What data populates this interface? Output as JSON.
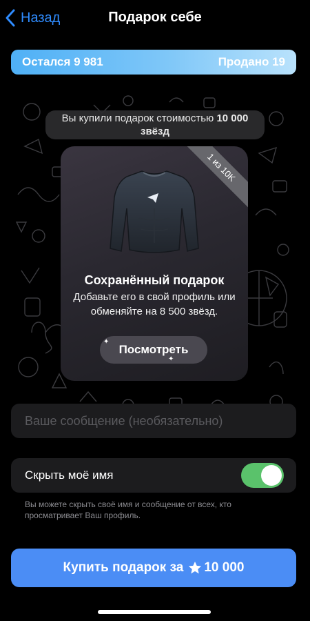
{
  "nav": {
    "back_label": "Назад",
    "title": "Подарок себе"
  },
  "stock": {
    "remaining": "Остался 9 981",
    "sold": "Продано 19"
  },
  "purchase_note": {
    "prefix": "Вы купили подарок стоимостью ",
    "amount": "10 000",
    "suffix": "звёзд"
  },
  "gift_card": {
    "ribbon": "1 из 10K",
    "title": "Сохранённый подарок",
    "description": "Добавьте его в свой профиль или обменяйте на 8 500 звёзд.",
    "view_button": "Посмотреть"
  },
  "message": {
    "placeholder": "Ваше сообщение (необязательно)",
    "value": ""
  },
  "hide_name": {
    "label": "Скрыть моё имя",
    "enabled": true,
    "hint": "Вы можете скрыть своё имя и сообщение от всех, кто просматривает Ваш профиль."
  },
  "buy_button": {
    "prefix": "Купить подарок за",
    "amount": "10 000",
    "icon": "star-icon"
  },
  "colors": {
    "accent": "#2f8cff",
    "buy_button": "#4b8df5",
    "toggle_on": "#5ac26b",
    "stock_bar_start": "#4fb0f6",
    "stock_bar_end": "#b9e2fc"
  }
}
